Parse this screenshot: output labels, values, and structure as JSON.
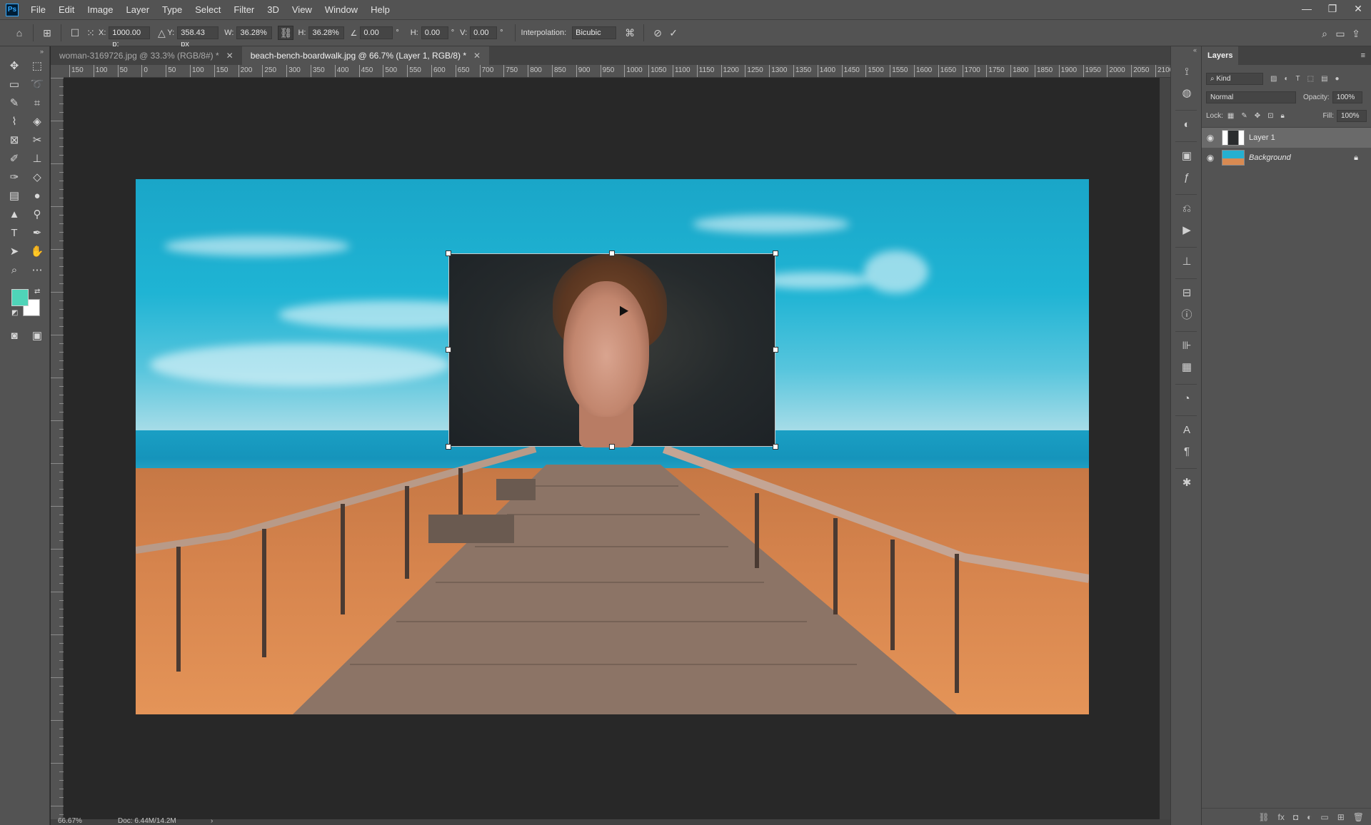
{
  "app": {
    "logo": "Ps",
    "menu": [
      "File",
      "Edit",
      "Image",
      "Layer",
      "Type",
      "Select",
      "Filter",
      "3D",
      "View",
      "Window",
      "Help"
    ],
    "window_controls": [
      "—",
      "❐",
      "✕"
    ]
  },
  "options_bar": {
    "x_label": "X:",
    "x_value": "1000.00 p:",
    "y_label": "Y:",
    "y_value": "358.43 px",
    "w_label": "W:",
    "w_value": "36.28%",
    "h_label": "H:",
    "h_value": "36.28%",
    "angle_value": "0.00",
    "angle_unit": "°",
    "hskew_label": "H:",
    "hskew_value": "0.00",
    "hskew_unit": "°",
    "vskew_label": "V:",
    "vskew_value": "0.00",
    "vskew_unit": "°",
    "interpolation_label": "Interpolation:",
    "interpolation_value": "Bicubic"
  },
  "tabs": [
    {
      "label": "woman-3169726.jpg @ 33.3% (RGB/8#) *",
      "active": false
    },
    {
      "label": "beach-bench-boardwalk.jpg @ 66.7% (Layer 1, RGB/8) *",
      "active": true
    }
  ],
  "ruler_top": [
    "150",
    "100",
    "50",
    "0",
    "50",
    "100",
    "150",
    "200",
    "250",
    "300",
    "350",
    "400",
    "450",
    "500",
    "550",
    "600",
    "650",
    "700",
    "750",
    "800",
    "850",
    "900",
    "950",
    "1000",
    "1050",
    "1100",
    "1150",
    "1200",
    "1250",
    "1300",
    "1350",
    "1400",
    "1450",
    "1500",
    "1550",
    "1600",
    "1650",
    "1700",
    "1750",
    "1800",
    "1850",
    "1900",
    "1950",
    "2000",
    "2050",
    "2100"
  ],
  "colors": {
    "foreground": "#4fd4b8",
    "background": "#ffffff"
  },
  "status": {
    "zoom": "66.67%",
    "doc": "Doc: 6.44M/14.2M",
    "arrow": "›"
  },
  "layers_panel": {
    "title": "Layers",
    "kind_placeholder": "Kind",
    "blend_mode": "Normal",
    "opacity_label": "Opacity:",
    "opacity_value": "100%",
    "lock_label": "Lock:",
    "fill_label": "Fill:",
    "fill_value": "100%",
    "layers": [
      {
        "name": "Layer 1",
        "selected": true
      },
      {
        "name": "Background",
        "selected": false
      }
    ]
  }
}
